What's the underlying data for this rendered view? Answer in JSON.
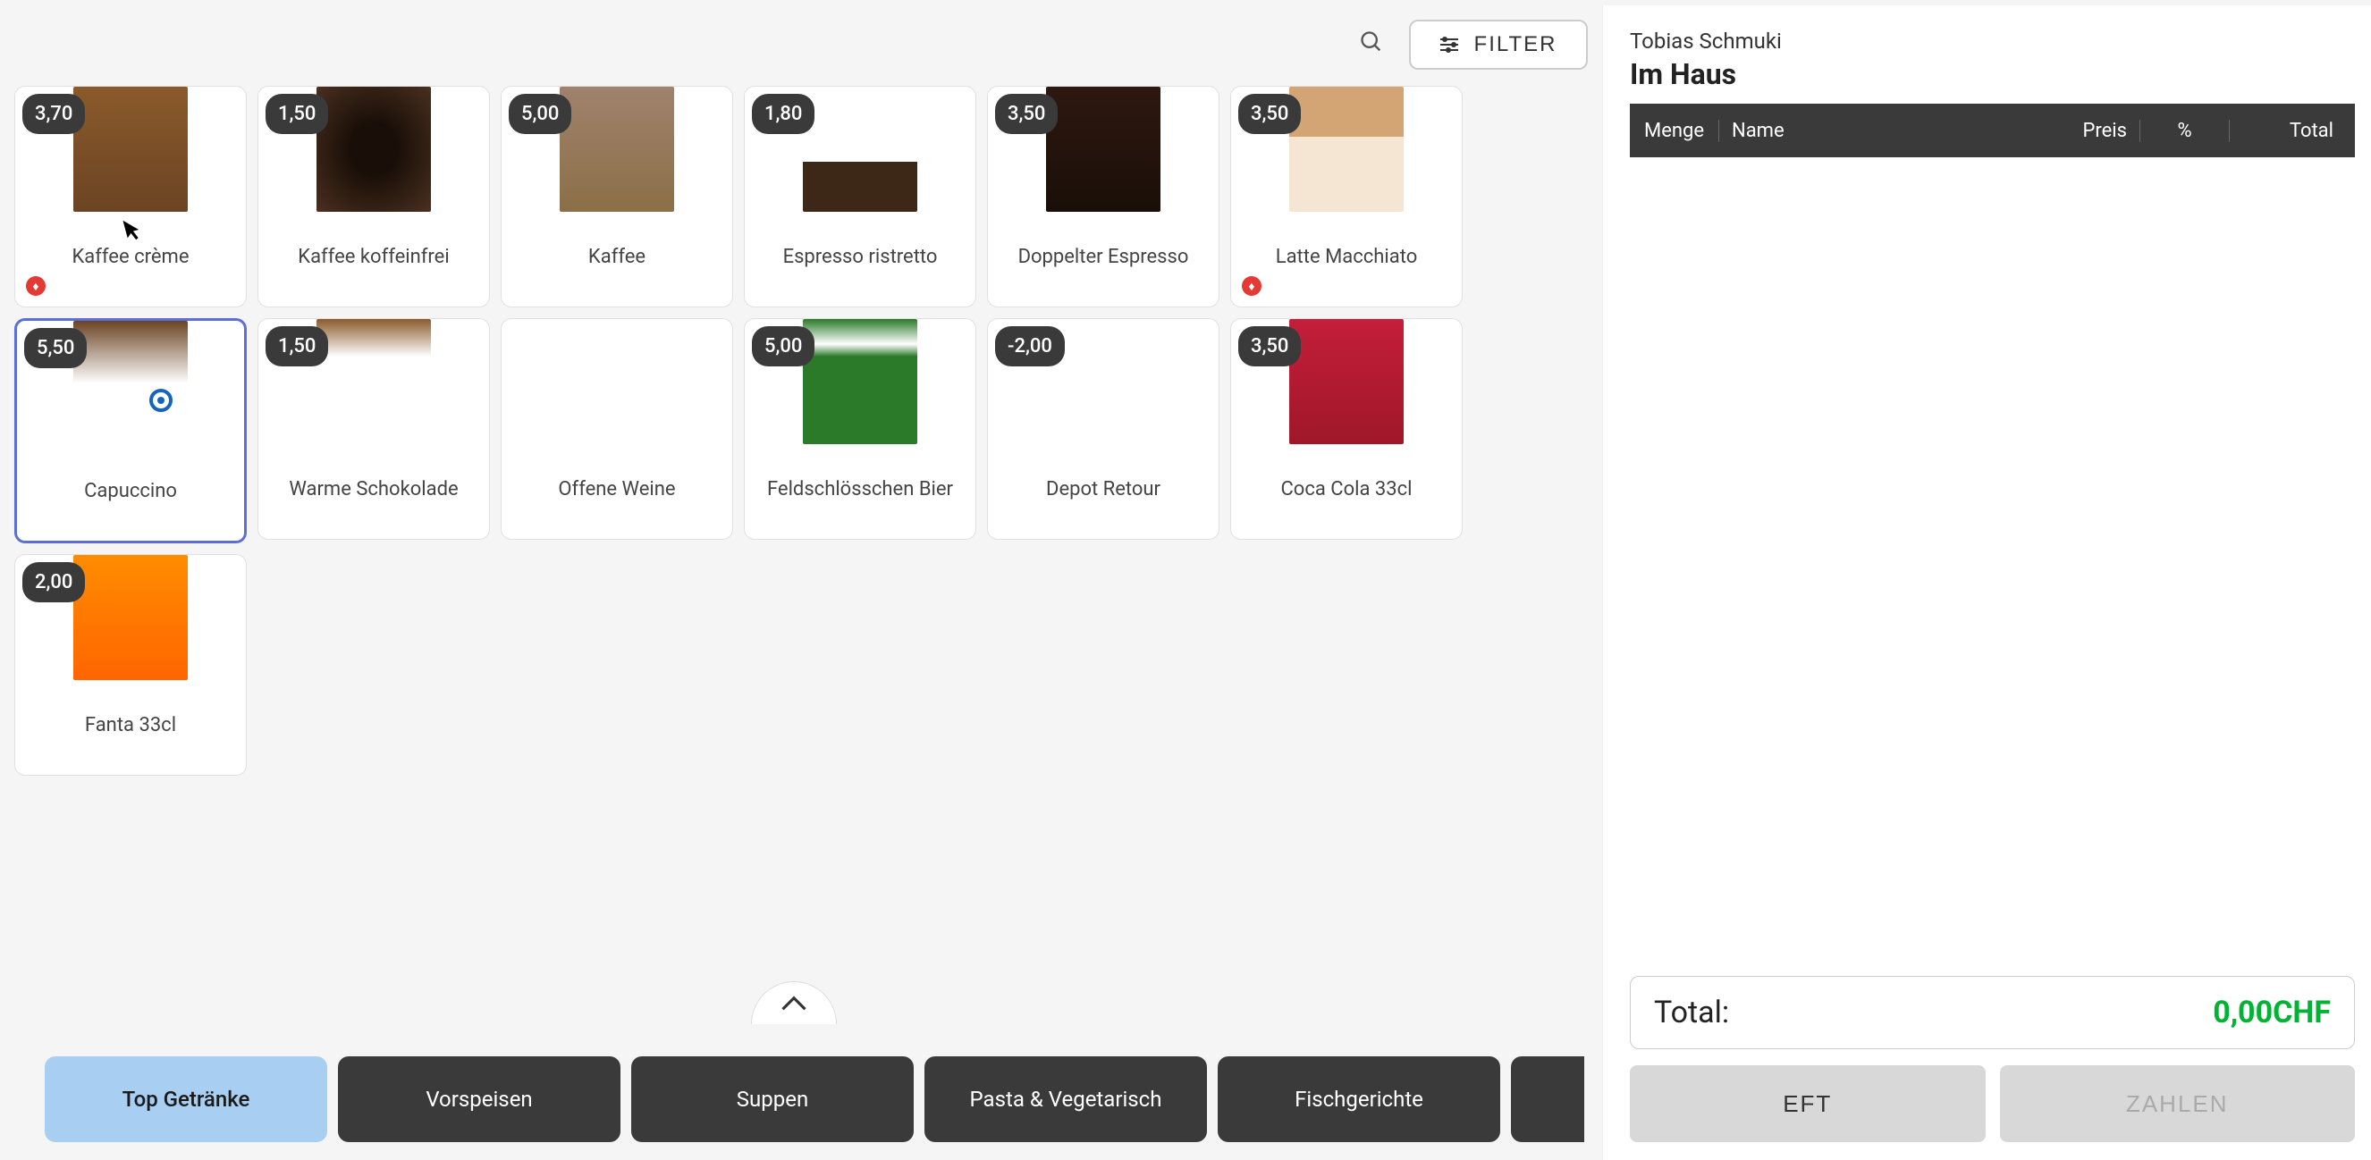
{
  "search": {
    "placeholder": ""
  },
  "filter_label": "FILTER",
  "products": [
    {
      "price": "3,70",
      "name": "Kaffee crème",
      "img": "img-coffee-cream",
      "flame": true
    },
    {
      "price": "1,50",
      "name": "Kaffee koffeinfrei",
      "img": "img-coffee-black"
    },
    {
      "price": "5,00",
      "name": "Kaffee",
      "img": "img-coffee-bowl"
    },
    {
      "price": "1,80",
      "name": "Espresso ristretto",
      "img": "img-espresso"
    },
    {
      "price": "3,50",
      "name": "Doppelter Espresso",
      "img": "img-double"
    },
    {
      "price": "3,50",
      "name": "Latte Macchiato",
      "img": "img-latte",
      "flame": true
    },
    {
      "price": "5,50",
      "name": "Capuccino",
      "img": "img-capu",
      "selected": true,
      "target": true
    },
    {
      "price": "1,50",
      "name": "Warme Schokolade",
      "img": "img-choco"
    },
    {
      "price": "",
      "name": "Offene Weine",
      "img": "img-wine"
    },
    {
      "price": "5,00",
      "name": "Feldschlösschen Bier",
      "img": "img-beer"
    },
    {
      "price": "-2,00",
      "name": "Depot Retour",
      "img": "img-none"
    },
    {
      "price": "3,50",
      "name": "Coca Cola 33cl",
      "img": "img-cola"
    },
    {
      "price": "2,00",
      "name": "Fanta 33cl",
      "img": "img-fanta"
    }
  ],
  "categories": [
    {
      "label": "Top Getränke",
      "active": true
    },
    {
      "label": "Vorspeisen"
    },
    {
      "label": "Suppen"
    },
    {
      "label": "Pasta & Vegetarisch"
    },
    {
      "label": "Fischgerichte"
    },
    {
      "label": ""
    }
  ],
  "order": {
    "customer": "Tobias Schmuki",
    "location": "Im Haus",
    "headers": {
      "menge": "Menge",
      "name": "Name",
      "preis": "Preis",
      "pct": "%",
      "total": "Total"
    },
    "total_label": "Total:",
    "total_value": "0,00CHF",
    "eft_label": "EFT",
    "pay_label": "ZAHLEN"
  }
}
